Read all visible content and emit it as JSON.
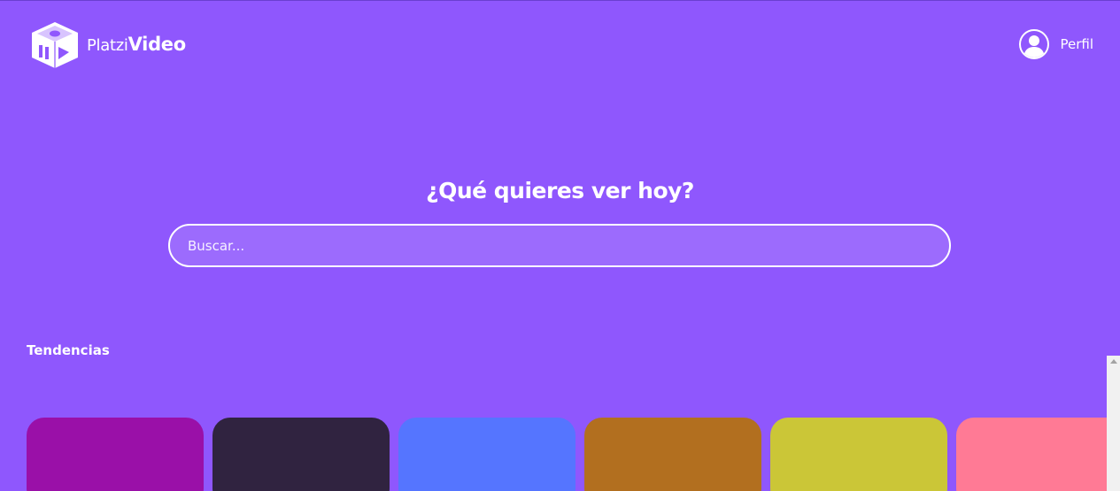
{
  "header": {
    "logo": {
      "name_light": "Platzi",
      "name_bold": "Video",
      "icon": "platzivideo-logo-icon"
    },
    "profile": {
      "label": "Perfil",
      "icon": "user-avatar-icon"
    }
  },
  "main": {
    "title": "¿Qué quieres ver hoy?",
    "search": {
      "placeholder": "Buscar...",
      "value": ""
    }
  },
  "trends": {
    "title": "Tendencias",
    "items": [
      {
        "color": "#9a10a8"
      },
      {
        "color": "#302340"
      },
      {
        "color": "#5575ff"
      },
      {
        "color": "#b26f1f"
      },
      {
        "color": "#cbc637"
      },
      {
        "color": "#ff7a95"
      }
    ]
  },
  "colors": {
    "background": "#8f57fd",
    "text": "#ffffff"
  }
}
